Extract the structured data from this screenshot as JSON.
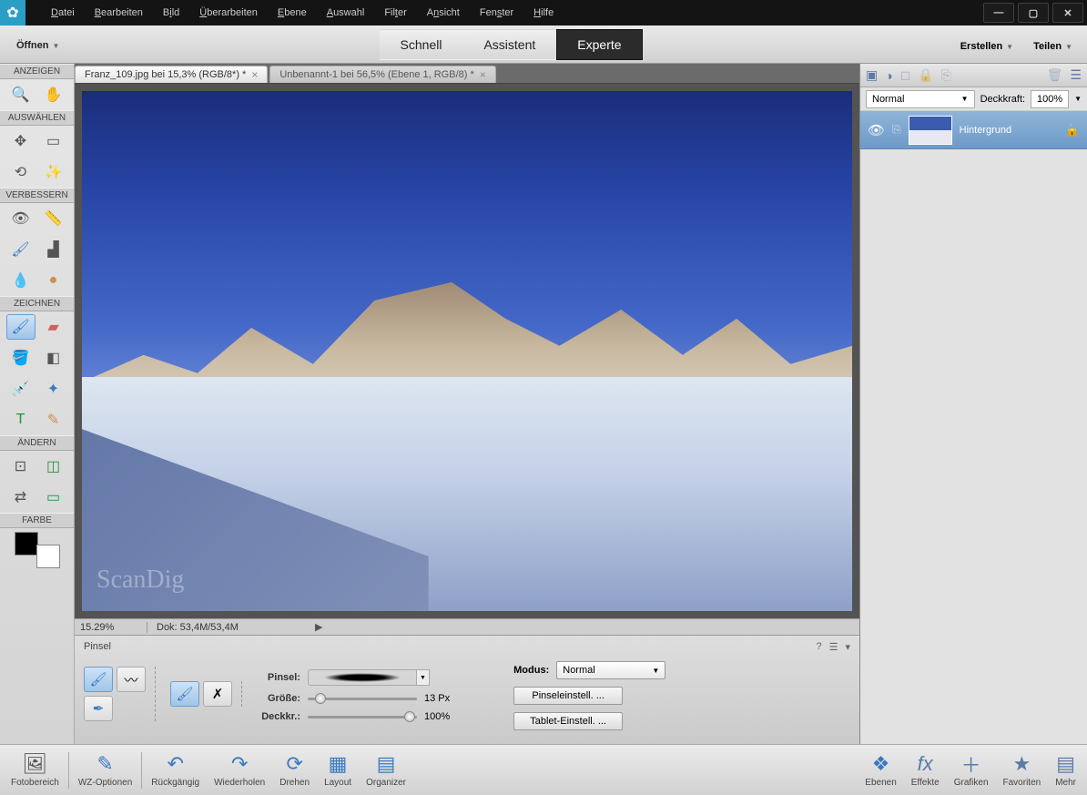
{
  "menu": {
    "items": [
      "Datei",
      "Bearbeiten",
      "Bild",
      "Überarbeiten",
      "Ebene",
      "Auswahl",
      "Filter",
      "Ansicht",
      "Fenster",
      "Hilfe"
    ]
  },
  "topbar": {
    "open": "Öffnen",
    "modes": [
      "Schnell",
      "Assistent",
      "Experte"
    ],
    "active_mode": 2,
    "create": "Erstellen",
    "share": "Teilen"
  },
  "tools": {
    "sections": [
      {
        "label": "ANZEIGEN"
      },
      {
        "label": "AUSWÄHLEN"
      },
      {
        "label": "VERBESSERN"
      },
      {
        "label": "ZEICHNEN"
      },
      {
        "label": "ÄNDERN"
      },
      {
        "label": "FARBE"
      }
    ]
  },
  "doc_tabs": [
    {
      "label": "Franz_109.jpg bei 15,3% (RGB/8*) *",
      "active": true
    },
    {
      "label": "Unbenannt-1 bei 56,5% (Ebene 1, RGB/8) *",
      "active": false
    }
  ],
  "watermark": "ScanDig",
  "status": {
    "zoom": "15.29%",
    "doc": "Dok: 53,4M/53,4M"
  },
  "options": {
    "title": "Pinsel",
    "brush_label": "Pinsel:",
    "size_label": "Größe:",
    "size_val": "13 Px",
    "opacity_label": "Deckkr.:",
    "opacity_val": "100%",
    "mode_label": "Modus:",
    "mode_val": "Normal",
    "brush_settings": "Pinseleinstell. ...",
    "tablet_settings": "Tablet-Einstell. ..."
  },
  "layers": {
    "blend": "Normal",
    "opacity_label": "Deckkraft:",
    "opacity_val": "100%",
    "layer_name": "Hintergrund"
  },
  "bottombar": {
    "left": [
      {
        "label": "Fotobereich",
        "icon": "🖼"
      },
      {
        "label": "WZ-Optionen",
        "icon": "✎"
      }
    ],
    "mid": [
      {
        "label": "Rückgängig",
        "icon": "↶"
      },
      {
        "label": "Wiederholen",
        "icon": "↷"
      },
      {
        "label": "Drehen",
        "icon": "⟳"
      },
      {
        "label": "Layout",
        "icon": "▦"
      },
      {
        "label": "Organizer",
        "icon": "▤"
      }
    ],
    "right": [
      {
        "label": "Ebenen",
        "icon": "❖"
      },
      {
        "label": "Effekte",
        "icon": "fx"
      },
      {
        "label": "Grafiken",
        "icon": "＋"
      },
      {
        "label": "Favoriten",
        "icon": "★"
      },
      {
        "label": "Mehr",
        "icon": "▤"
      }
    ]
  }
}
